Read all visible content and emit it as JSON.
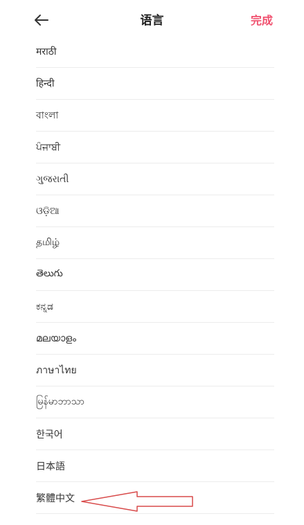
{
  "header": {
    "back_icon": "arrow-left-icon",
    "title": "语言",
    "done_label": "完成"
  },
  "languages": [
    "मराठी",
    "हिन्दी",
    "বাংলা",
    "ਪੰਜਾਬੀ",
    "ગુજરાતી",
    "ଓଡ଼ିଆ",
    "தமிழ்",
    "తెలుగు",
    "ಕನ್ನಡ",
    "മലയാളം",
    "ภาษาไทย",
    "မြန်မာဘာသာ",
    "한국어",
    "日本語",
    "繁體中文"
  ],
  "annotation": {
    "arrow_color": "#d84a4a",
    "points_to": "繁體中文"
  },
  "colors": {
    "accent": "#f0506e",
    "divider": "#ececec",
    "text": "#333333"
  }
}
